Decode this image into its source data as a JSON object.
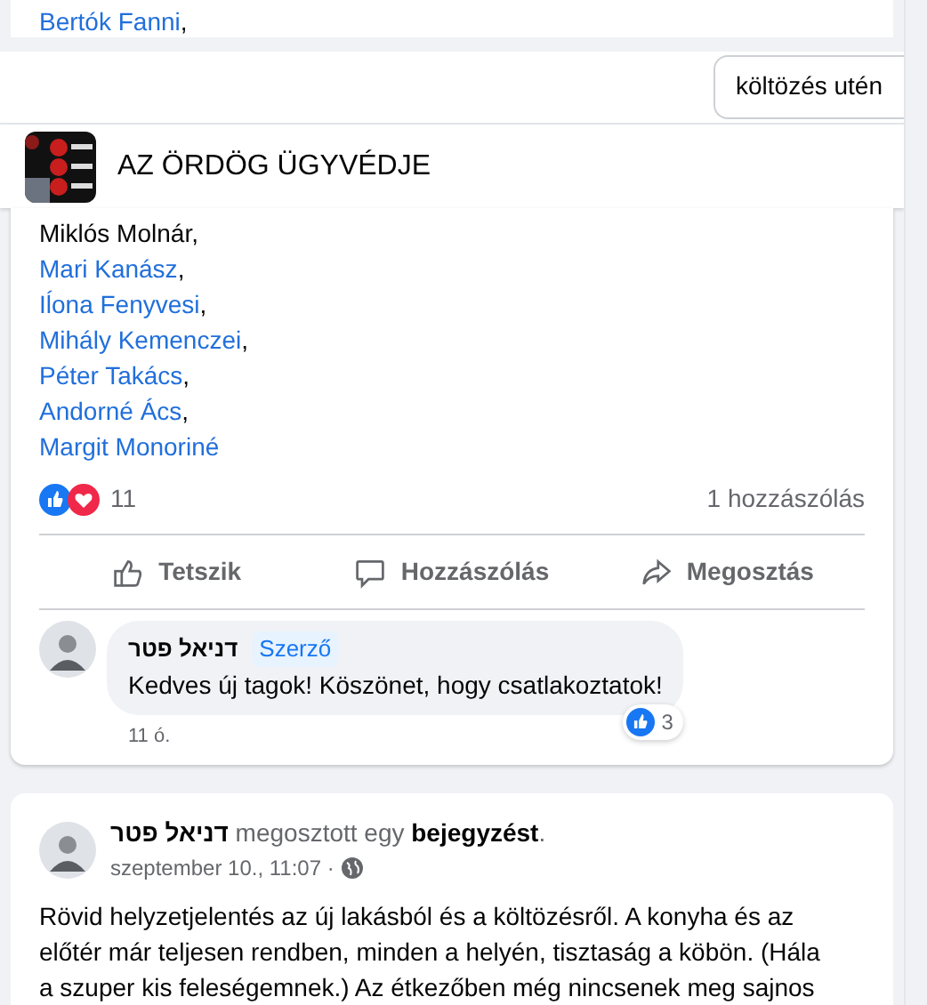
{
  "top_card": {
    "name": "Bertók Fanni",
    "suffix": ","
  },
  "search": {
    "value": "költözés utén"
  },
  "group": {
    "name": "AZ ÖRDÖG ÜGYVÉDJE"
  },
  "post": {
    "members": [
      {
        "name": "Miklós Molnár",
        "link": false,
        "suffix": ","
      },
      {
        "name": "Mari Kanász",
        "link": true,
        "suffix": ","
      },
      {
        "name": "Iĺona Fenyvesi",
        "link": true,
        "suffix": ","
      },
      {
        "name": "Mihály Kemenczei",
        "link": true,
        "suffix": ","
      },
      {
        "name": "Péter Takács",
        "link": true,
        "suffix": ","
      },
      {
        "name": "Andorné Ács",
        "link": true,
        "suffix": ","
      },
      {
        "name": "Margit Monoriné",
        "link": true
      }
    ],
    "reaction_count": "11",
    "comment_count": "1 hozzászólás",
    "actions": [
      {
        "kind": "like",
        "label": "Tetszik"
      },
      {
        "kind": "comment",
        "label": "Hozzászólás"
      },
      {
        "kind": "share",
        "label": "Megosztás"
      }
    ],
    "comment": {
      "author": "דניאל פטר",
      "badge": "Szerző",
      "text": "Kedves új tagok! Köszönet, hogy csatlakoztatok!",
      "likes": "3",
      "time": "11 ó."
    }
  },
  "next_post": {
    "author": "דניאל פטר",
    "verb": "megosztott egy",
    "object": "bejegyzést",
    "end": ".",
    "date": "szeptember 10., 11:07 ·",
    "lines": [
      "Rövid helyzetjelentés az új lakásból és a költözésről. A konyha és az",
      "előtér már teljesen rendben, minden a helyén, tisztaság a köbön. (Hála",
      "a szuper kis feleségemnek.) Az étkezőben még nincsenek meg sajnos"
    ]
  }
}
